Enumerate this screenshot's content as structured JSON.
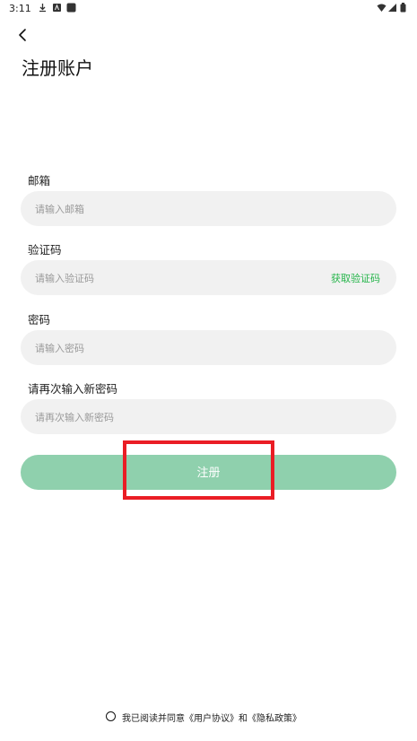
{
  "status_bar": {
    "time": "3:11",
    "icons": [
      "download-icon",
      "a-box-icon",
      "square-icon",
      "wifi-icon",
      "signal-icon",
      "battery-icon"
    ]
  },
  "page": {
    "title": "注册账户"
  },
  "form": {
    "email": {
      "label": "邮箱",
      "placeholder": "请输入邮箱"
    },
    "code": {
      "label": "验证码",
      "placeholder": "请输入验证码",
      "action": "获取验证码"
    },
    "password": {
      "label": "密码",
      "placeholder": "请输入密码"
    },
    "confirm": {
      "label": "请再次输入新密码",
      "placeholder": "请再次输入新密码"
    },
    "submit_label": "注册"
  },
  "agreement": {
    "text": "我已阅读并同意《用户协议》和《隐私政策》"
  },
  "colors": {
    "accent_green": "#25b54a",
    "button_bg": "#8fd0ad",
    "field_bg": "#f1f1f1",
    "highlight_red": "#ea1d25"
  }
}
